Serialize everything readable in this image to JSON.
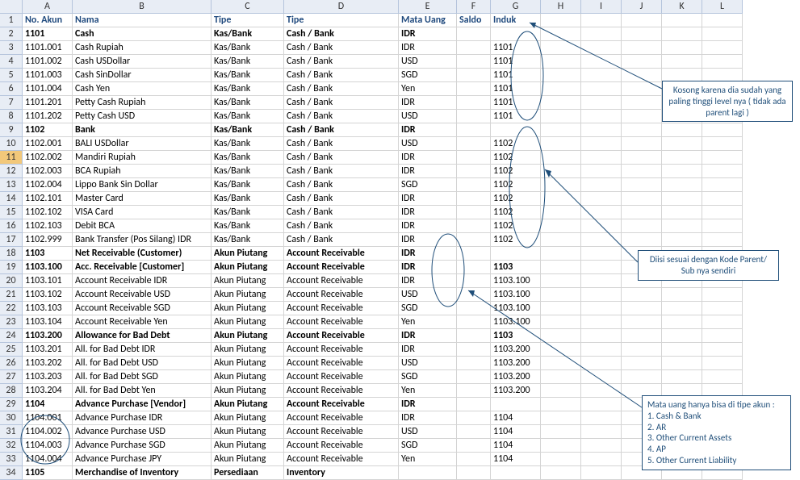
{
  "columns_letters": [
    "",
    "A",
    "B",
    "C",
    "D",
    "E",
    "F",
    "G",
    "H",
    "I",
    "J",
    "K",
    "L"
  ],
  "headers": {
    "A": "No. Akun",
    "B": "Nama",
    "C": "Tipe",
    "D": "Tipe",
    "E": "Mata Uang",
    "F": "Saldo",
    "G": "Induk"
  },
  "rows": [
    {
      "n": 2,
      "bold": true,
      "A": "1101",
      "B": "Cash",
      "C": "Kas/Bank",
      "D": "Cash / Bank",
      "E": "IDR",
      "G": ""
    },
    {
      "n": 3,
      "A": "1101.001",
      "B": "Cash Rupiah",
      "C": "Kas/Bank",
      "D": "Cash / Bank",
      "E": "IDR",
      "G": "1101"
    },
    {
      "n": 4,
      "A": "1101.002",
      "B": "Cash USDollar",
      "C": "Kas/Bank",
      "D": "Cash / Bank",
      "E": "USD",
      "G": "1101"
    },
    {
      "n": 5,
      "A": "1101.003",
      "B": "Cash SinDollar",
      "C": "Kas/Bank",
      "D": "Cash / Bank",
      "E": "SGD",
      "G": "1101"
    },
    {
      "n": 6,
      "A": "1101.004",
      "B": "Cash Yen",
      "C": "Kas/Bank",
      "D": "Cash / Bank",
      "E": "Yen",
      "G": "1101"
    },
    {
      "n": 7,
      "A": "1101.201",
      "B": "Petty Cash Rupiah",
      "C": "Kas/Bank",
      "D": "Cash / Bank",
      "E": "IDR",
      "G": "1101"
    },
    {
      "n": 8,
      "A": "1101.202",
      "B": "Petty Cash USD",
      "C": "Kas/Bank",
      "D": "Cash / Bank",
      "E": "USD",
      "G": "1101"
    },
    {
      "n": 9,
      "bold": true,
      "A": "1102",
      "B": "Bank",
      "C": "Kas/Bank",
      "D": "Cash / Bank",
      "E": "IDR",
      "G": ""
    },
    {
      "n": 10,
      "A": "1102.001",
      "B": "BALI USDollar",
      "C": "Kas/Bank",
      "D": "Cash / Bank",
      "E": "USD",
      "G": "1102"
    },
    {
      "n": 11,
      "A": "1102.002",
      "B": "Mandiri Rupiah",
      "C": "Kas/Bank",
      "D": "Cash / Bank",
      "E": "IDR",
      "G": "1102"
    },
    {
      "n": 12,
      "A": "1102.003",
      "B": "BCA Rupiah",
      "C": "Kas/Bank",
      "D": "Cash / Bank",
      "E": "IDR",
      "G": "1102"
    },
    {
      "n": 13,
      "A": "1102.004",
      "B": "Lippo Bank Sin Dollar",
      "C": "Kas/Bank",
      "D": "Cash / Bank",
      "E": "SGD",
      "G": "1102"
    },
    {
      "n": 14,
      "A": "1102.101",
      "B": "Master Card",
      "C": "Kas/Bank",
      "D": "Cash / Bank",
      "E": "IDR",
      "G": "1102"
    },
    {
      "n": 15,
      "A": "1102.102",
      "B": "VISA Card",
      "C": "Kas/Bank",
      "D": "Cash / Bank",
      "E": "IDR",
      "G": "1102"
    },
    {
      "n": 16,
      "A": "1102.103",
      "B": "Debit BCA",
      "C": "Kas/Bank",
      "D": "Cash / Bank",
      "E": "IDR",
      "G": "1102"
    },
    {
      "n": 17,
      "A": "1102.999",
      "B": "Bank Transfer (Pos Silang) IDR",
      "C": "Kas/Bank",
      "D": "Cash / Bank",
      "E": "IDR",
      "G": "1102"
    },
    {
      "n": 18,
      "bold": true,
      "A": "1103",
      "B": "Net Receivable (Customer)",
      "C": "Akun Piutang",
      "D": "Account Receivable",
      "E": "IDR",
      "G": ""
    },
    {
      "n": 19,
      "bold": true,
      "A": "1103.100",
      "B": "Acc. Receivable [Customer]",
      "C": "Akun Piutang",
      "D": "Account Receivable",
      "E": "IDR",
      "G": "1103"
    },
    {
      "n": 20,
      "A": "1103.101",
      "B": "Account Receivable IDR",
      "C": "Akun Piutang",
      "D": "Account Receivable",
      "E": "IDR",
      "G": "1103.100"
    },
    {
      "n": 21,
      "A": "1103.102",
      "B": "Account Receivable USD",
      "C": "Akun Piutang",
      "D": "Account Receivable",
      "E": "USD",
      "G": "1103.100"
    },
    {
      "n": 22,
      "A": "1103.103",
      "B": "Account Receivable SGD",
      "C": "Akun Piutang",
      "D": "Account Receivable",
      "E": "SGD",
      "G": "1103.100"
    },
    {
      "n": 23,
      "A": "1103.104",
      "B": "Account Receivable Yen",
      "C": "Akun Piutang",
      "D": "Account Receivable",
      "E": "Yen",
      "G": "1103.100"
    },
    {
      "n": 24,
      "bold": true,
      "A": "1103.200",
      "B": "Allowance for Bad Debt",
      "C": "Akun Piutang",
      "D": "Account Receivable",
      "E": "IDR",
      "G": "1103"
    },
    {
      "n": 25,
      "A": "1103.201",
      "B": "All. for Bad Debt IDR",
      "C": "Akun Piutang",
      "D": "Account Receivable",
      "E": "IDR",
      "G": "1103.200"
    },
    {
      "n": 26,
      "A": "1103.202",
      "B": "All. for Bad Debt USD",
      "C": "Akun Piutang",
      "D": "Account Receivable",
      "E": "USD",
      "G": "1103.200"
    },
    {
      "n": 27,
      "A": "1103.203",
      "B": "All. for Bad Debt SGD",
      "C": "Akun Piutang",
      "D": "Account Receivable",
      "E": "SGD",
      "G": "1103.200"
    },
    {
      "n": 28,
      "A": "1103.204",
      "B": "All. for Bad Debt Yen",
      "C": "Akun Piutang",
      "D": "Account Receivable",
      "E": "Yen",
      "G": "1103.200"
    },
    {
      "n": 29,
      "bold": true,
      "A": "1104",
      "B": "Advance Purchase [Vendor]",
      "C": "Akun Piutang",
      "D": "Account Receivable",
      "E": "IDR",
      "G": ""
    },
    {
      "n": 30,
      "A": "1104.001",
      "B": "Advance Purchase IDR",
      "C": "Akun Piutang",
      "D": "Account Receivable",
      "E": "IDR",
      "G": "1104"
    },
    {
      "n": 31,
      "A": "1104.002",
      "B": "Advance Purchase USD",
      "C": "Akun Piutang",
      "D": "Account Receivable",
      "E": "USD",
      "G": "1104"
    },
    {
      "n": 32,
      "A": "1104.003",
      "B": "Advance Purchase SGD",
      "C": "Akun Piutang",
      "D": "Account Receivable",
      "E": "SGD",
      "G": "1104"
    },
    {
      "n": 33,
      "A": "1104.004",
      "B": "Advance Purchase JPY",
      "C": "Akun Piutang",
      "D": "Account Receivable",
      "E": "Yen",
      "G": "1104"
    },
    {
      "n": 34,
      "bold": true,
      "A": "1105",
      "B": "Merchandise of Inventory",
      "C": "Persediaan",
      "D": "Inventory",
      "E": "",
      "G": ""
    }
  ],
  "callouts": {
    "c1": "Kosong karena dia sudah yang paling tinggi level nya ( tidak ada parent lagi )",
    "c2": "Diisi sesuai dengan Kode Parent/ Sub nya sendiri",
    "c3": {
      "title": "Mata uang hanya bisa di tipe akun :",
      "items": [
        "1. Cash & Bank",
        "2. AR",
        "3. Other Current Assets",
        "4. AP",
        "5. Other Current Liability"
      ]
    }
  },
  "selected_row": 11
}
